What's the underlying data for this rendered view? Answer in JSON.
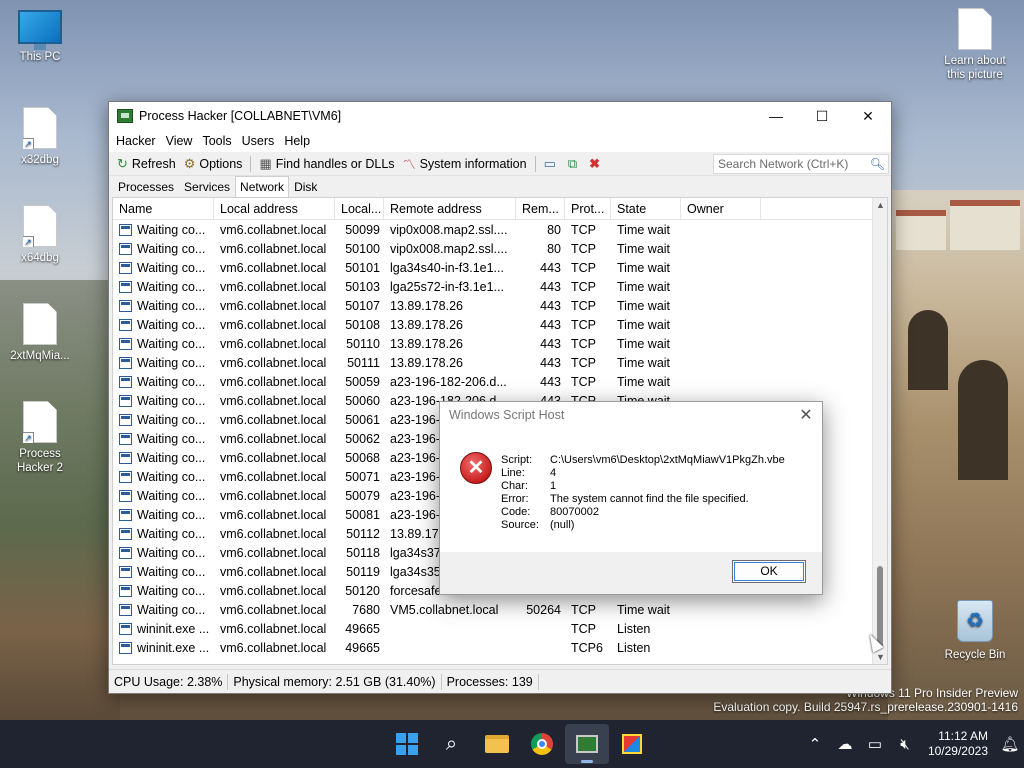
{
  "desktop": {
    "icons": [
      {
        "label": "This PC",
        "type": "pc"
      },
      {
        "label": "x32dbg",
        "type": "file",
        "shortcut": true
      },
      {
        "label": "x64dbg",
        "type": "file",
        "shortcut": true
      },
      {
        "label": "2xtMqMia...",
        "type": "file",
        "shortcut": false
      },
      {
        "label": "Process Hacker 2",
        "type": "file",
        "shortcut": true
      },
      {
        "label": "Learn about this picture",
        "type": "file",
        "shortcut": false
      },
      {
        "label": "Recycle Bin",
        "type": "recycle"
      }
    ],
    "watermark": {
      "line1": "Windows 11 Pro Insider Preview",
      "line2": "Evaluation copy. Build 25947.rs_prerelease.230901-1416"
    }
  },
  "window": {
    "title": "Process Hacker [COLLABNET\\VM6]",
    "controls": {
      "minimize": "—",
      "maximize": "☐",
      "close": "✕"
    },
    "menu": [
      "Hacker",
      "View",
      "Tools",
      "Users",
      "Help"
    ],
    "toolbar": {
      "refresh": "Refresh",
      "options": "Options",
      "find_handles": "Find handles or DLLs",
      "system_info": "System information",
      "search_placeholder": "Search Network (Ctrl+K)"
    },
    "tabs": [
      "Processes",
      "Services",
      "Network",
      "Disk"
    ],
    "active_tab": "Network",
    "columns": [
      "Name",
      "Local address",
      "Local...",
      "Remote address",
      "Rem...",
      "Prot...",
      "State",
      "Owner"
    ],
    "rows": [
      [
        "Waiting co...",
        "vm6.collabnet.local",
        "50099",
        "vip0x008.map2.ssl....",
        "80",
        "TCP",
        "Time wait",
        ""
      ],
      [
        "Waiting co...",
        "vm6.collabnet.local",
        "50100",
        "vip0x008.map2.ssl....",
        "80",
        "TCP",
        "Time wait",
        ""
      ],
      [
        "Waiting co...",
        "vm6.collabnet.local",
        "50101",
        "lga34s40-in-f3.1e1...",
        "443",
        "TCP",
        "Time wait",
        ""
      ],
      [
        "Waiting co...",
        "vm6.collabnet.local",
        "50103",
        "lga25s72-in-f3.1e1...",
        "443",
        "TCP",
        "Time wait",
        ""
      ],
      [
        "Waiting co...",
        "vm6.collabnet.local",
        "50107",
        "13.89.178.26",
        "443",
        "TCP",
        "Time wait",
        ""
      ],
      [
        "Waiting co...",
        "vm6.collabnet.local",
        "50108",
        "13.89.178.26",
        "443",
        "TCP",
        "Time wait",
        ""
      ],
      [
        "Waiting co...",
        "vm6.collabnet.local",
        "50110",
        "13.89.178.26",
        "443",
        "TCP",
        "Time wait",
        ""
      ],
      [
        "Waiting co...",
        "vm6.collabnet.local",
        "50111",
        "13.89.178.26",
        "443",
        "TCP",
        "Time wait",
        ""
      ],
      [
        "Waiting co...",
        "vm6.collabnet.local",
        "50059",
        "a23-196-182-206.d...",
        "443",
        "TCP",
        "Time wait",
        ""
      ],
      [
        "Waiting co...",
        "vm6.collabnet.local",
        "50060",
        "a23-196-182-206.d...",
        "443",
        "TCP",
        "Time wait",
        ""
      ],
      [
        "Waiting co...",
        "vm6.collabnet.local",
        "50061",
        "a23-196-1",
        "",
        "",
        "",
        ""
      ],
      [
        "Waiting co...",
        "vm6.collabnet.local",
        "50062",
        "a23-196-1",
        "",
        "",
        "",
        ""
      ],
      [
        "Waiting co...",
        "vm6.collabnet.local",
        "50068",
        "a23-196-1",
        "",
        "",
        "",
        ""
      ],
      [
        "Waiting co...",
        "vm6.collabnet.local",
        "50071",
        "a23-196-1",
        "",
        "",
        "",
        ""
      ],
      [
        "Waiting co...",
        "vm6.collabnet.local",
        "50079",
        "a23-196-1",
        "",
        "",
        "",
        ""
      ],
      [
        "Waiting co...",
        "vm6.collabnet.local",
        "50081",
        "a23-196-1",
        "",
        "",
        "",
        ""
      ],
      [
        "Waiting co...",
        "vm6.collabnet.local",
        "50112",
        "13.89.178.",
        "",
        "",
        "",
        ""
      ],
      [
        "Waiting co...",
        "vm6.collabnet.local",
        "50118",
        "lga34s37-",
        "",
        "",
        "",
        ""
      ],
      [
        "Waiting co...",
        "vm6.collabnet.local",
        "50119",
        "lga34s35-",
        "",
        "",
        "",
        ""
      ],
      [
        "Waiting co...",
        "vm6.collabnet.local",
        "50120",
        "forcesafes",
        "",
        "",
        "",
        ""
      ],
      [
        "Waiting co...",
        "vm6.collabnet.local",
        "7680",
        "VM5.collabnet.local",
        "50264",
        "TCP",
        "Time wait",
        ""
      ],
      [
        "wininit.exe ...",
        "vm6.collabnet.local",
        "49665",
        "",
        "",
        "TCP",
        "Listen",
        ""
      ],
      [
        "wininit.exe ...",
        "vm6.collabnet.local",
        "49665",
        "",
        "",
        "TCP6",
        "Listen",
        ""
      ]
    ],
    "status": {
      "cpu": "CPU Usage: 2.38%",
      "memory": "Physical memory: 2.51 GB (31.40%)",
      "processes": "Processes: 139"
    }
  },
  "dialog": {
    "title": "Windows Script Host",
    "close": "✕",
    "lines": [
      {
        "key": "Script:",
        "value": "C:\\Users\\vm6\\Desktop\\2xtMqMiawV1PkgZh.vbe"
      },
      {
        "key": "Line:",
        "value": "4"
      },
      {
        "key": "Char:",
        "value": "1"
      },
      {
        "key": "Error:",
        "value": "The system cannot find the file specified."
      },
      {
        "key": "Code:",
        "value": "80070002"
      },
      {
        "key": "Source:",
        "value": "(null)"
      }
    ],
    "ok": "OK"
  },
  "taskbar": {
    "apps": [
      "start",
      "search",
      "file-explorer",
      "chrome",
      "process-hacker",
      "app"
    ],
    "clock_time": "11:12 AM",
    "clock_date": "10/29/2023"
  }
}
